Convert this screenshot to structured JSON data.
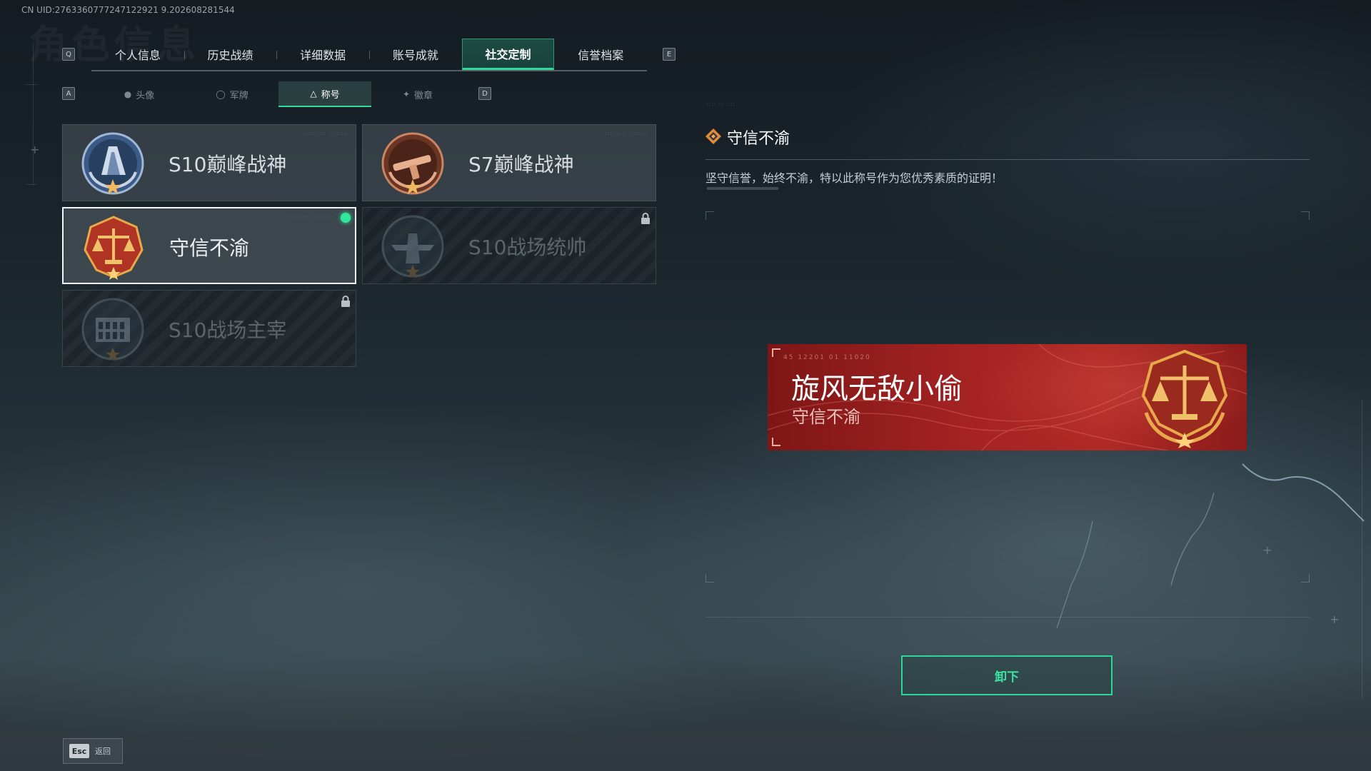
{
  "header": {
    "uid": "CN UID:2763360777247122921 9.202608281544",
    "ghost_title": "角色信息"
  },
  "main_tabs": {
    "prev_key": "Q",
    "next_key": "E",
    "items": [
      {
        "label": "个人信息",
        "active": false
      },
      {
        "label": "历史战绩",
        "active": false
      },
      {
        "label": "详细数据",
        "active": false
      },
      {
        "label": "账号成就",
        "active": false
      },
      {
        "label": "社交定制",
        "active": true
      },
      {
        "label": "信誉档案",
        "active": false
      }
    ]
  },
  "sub_tabs": {
    "prev_key": "A",
    "next_key": "D",
    "items": [
      {
        "label": "头像",
        "icon": "person-icon",
        "active": false
      },
      {
        "label": "军牌",
        "icon": "tag-icon",
        "active": false
      },
      {
        "label": "称号",
        "icon": "title-icon",
        "active": true
      },
      {
        "label": "徽章",
        "icon": "badge-icon",
        "active": false
      }
    ]
  },
  "titles": [
    {
      "name": "S10巅峰战神",
      "state": "unlocked",
      "medal": "peak-god-medal-icon"
    },
    {
      "name": "S7巅峰战神",
      "state": "unlocked",
      "medal": "weapon-medal-icon"
    },
    {
      "name": "守信不渝",
      "state": "selected-equipped",
      "medal": "justice-scale-medal-icon"
    },
    {
      "name": "S10战场统帅",
      "state": "locked",
      "medal": "aircraft-medal-icon"
    },
    {
      "name": "S10战场主宰",
      "state": "locked",
      "medal": "colosseum-medal-icon"
    }
  ],
  "detail": {
    "title": "守信不渝",
    "description": "坚守信誉，始终不渝，特以此称号作为您优秀素质的证明！"
  },
  "banner": {
    "player_name": "旋风无敌小偷",
    "title": "守信不渝",
    "code": "45 12201 01 11020"
  },
  "actions": {
    "unequip_label": "卸下"
  },
  "footer": {
    "esc_key": "Esc",
    "esc_label": "返回"
  },
  "colors": {
    "accent": "#2fdc9c",
    "banner_red": "#a32222",
    "medal_gold": "#e7a94a"
  }
}
